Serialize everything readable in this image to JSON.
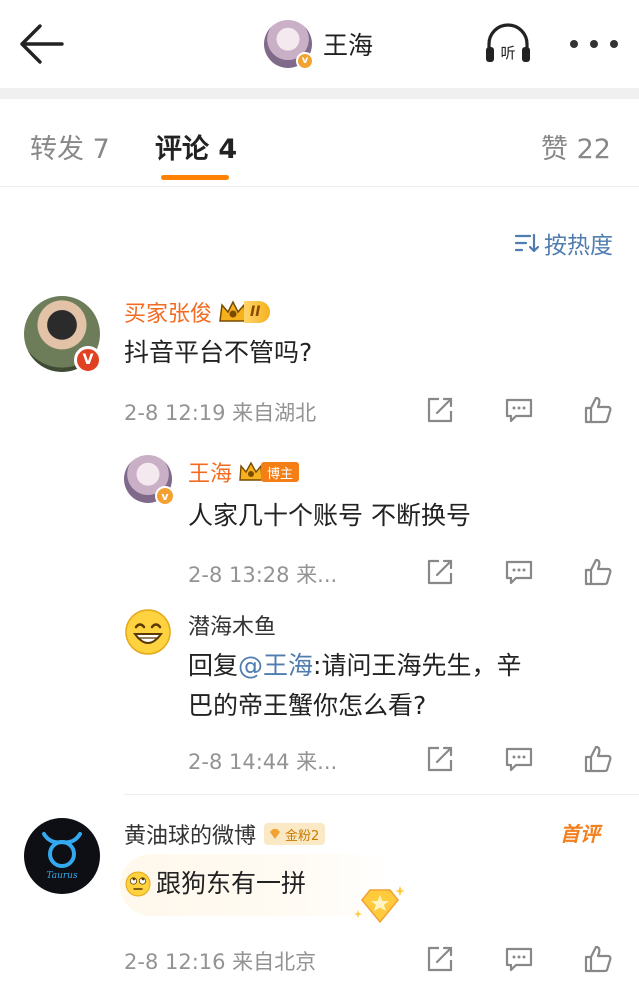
{
  "header": {
    "title": "王海",
    "listen_label": "听"
  },
  "tabs": {
    "repost": "转发 7",
    "comment": "评论 4",
    "like": "赞 22"
  },
  "sort": {
    "label": "按热度"
  },
  "comments": [
    {
      "user": "买家张俊",
      "level_tag": "II",
      "text": "抖音平台不管吗?",
      "meta": "2-8 12:19  来自湖北",
      "replies": [
        {
          "user": "王海",
          "tag": "博主",
          "text": "人家几十个账号 不断换号",
          "meta": "2-8 13:28  来..."
        },
        {
          "user": "潜海木鱼",
          "text_prefix": "回复",
          "mention": "@王海",
          "text_line1_rest": ":请问王海先生，辛",
          "text_line2": "巴的帝王蟹你怎么看?",
          "meta": "2-8 14:44  来..."
        }
      ]
    },
    {
      "user": "黄油球的微博",
      "fan_tag": "金粉2",
      "badge": "首评",
      "text": "跟狗东有一拼",
      "meta": "2-8 12:16  来自北京",
      "avatar_text": "Taurus"
    }
  ],
  "colors": {
    "accent": "#ff8200",
    "username_orange": "#f36b21",
    "link_blue": "#507daf",
    "meta_gray": "#939393"
  }
}
